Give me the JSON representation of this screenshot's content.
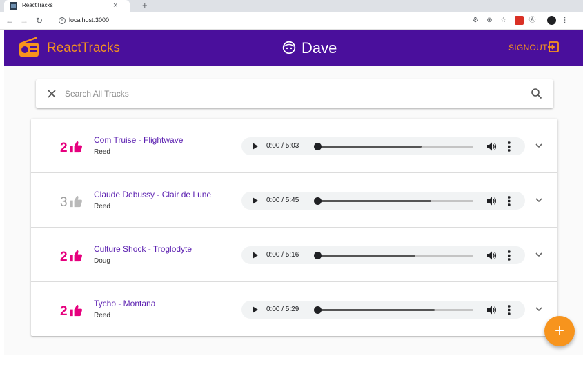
{
  "browser": {
    "tab_title": "ReactTracks",
    "tab_close": "×",
    "new_tab": "+",
    "url": "localhost:3000"
  },
  "header": {
    "brand": "ReactTracks",
    "username": "Dave",
    "signout_label": "SIGNOUT"
  },
  "search": {
    "placeholder": "Search All Tracks",
    "value": ""
  },
  "tracks": [
    {
      "likes": "2",
      "liked": true,
      "title": "Com Truise - Flightwave",
      "artist": "Reed",
      "time": "0:00 / 5:03",
      "progress": 0.67
    },
    {
      "likes": "3",
      "liked": false,
      "title": "Claude Debussy - Clair de Lune",
      "artist": "Reed",
      "time": "0:00 / 5:45",
      "progress": 0.73
    },
    {
      "likes": "2",
      "liked": true,
      "title": "Culture Shock - Troglodyte",
      "artist": "Doug",
      "time": "0:00 / 5:16",
      "progress": 0.63
    },
    {
      "likes": "2",
      "liked": true,
      "title": "Tycho - Montana",
      "artist": "Reed",
      "time": "0:00 / 5:29",
      "progress": 0.75
    }
  ],
  "fab_label": "+",
  "colors": {
    "appbar": "#4a0f9c",
    "accent": "#f7941d",
    "like": "#e6007e",
    "title": "#5b1fb0"
  }
}
